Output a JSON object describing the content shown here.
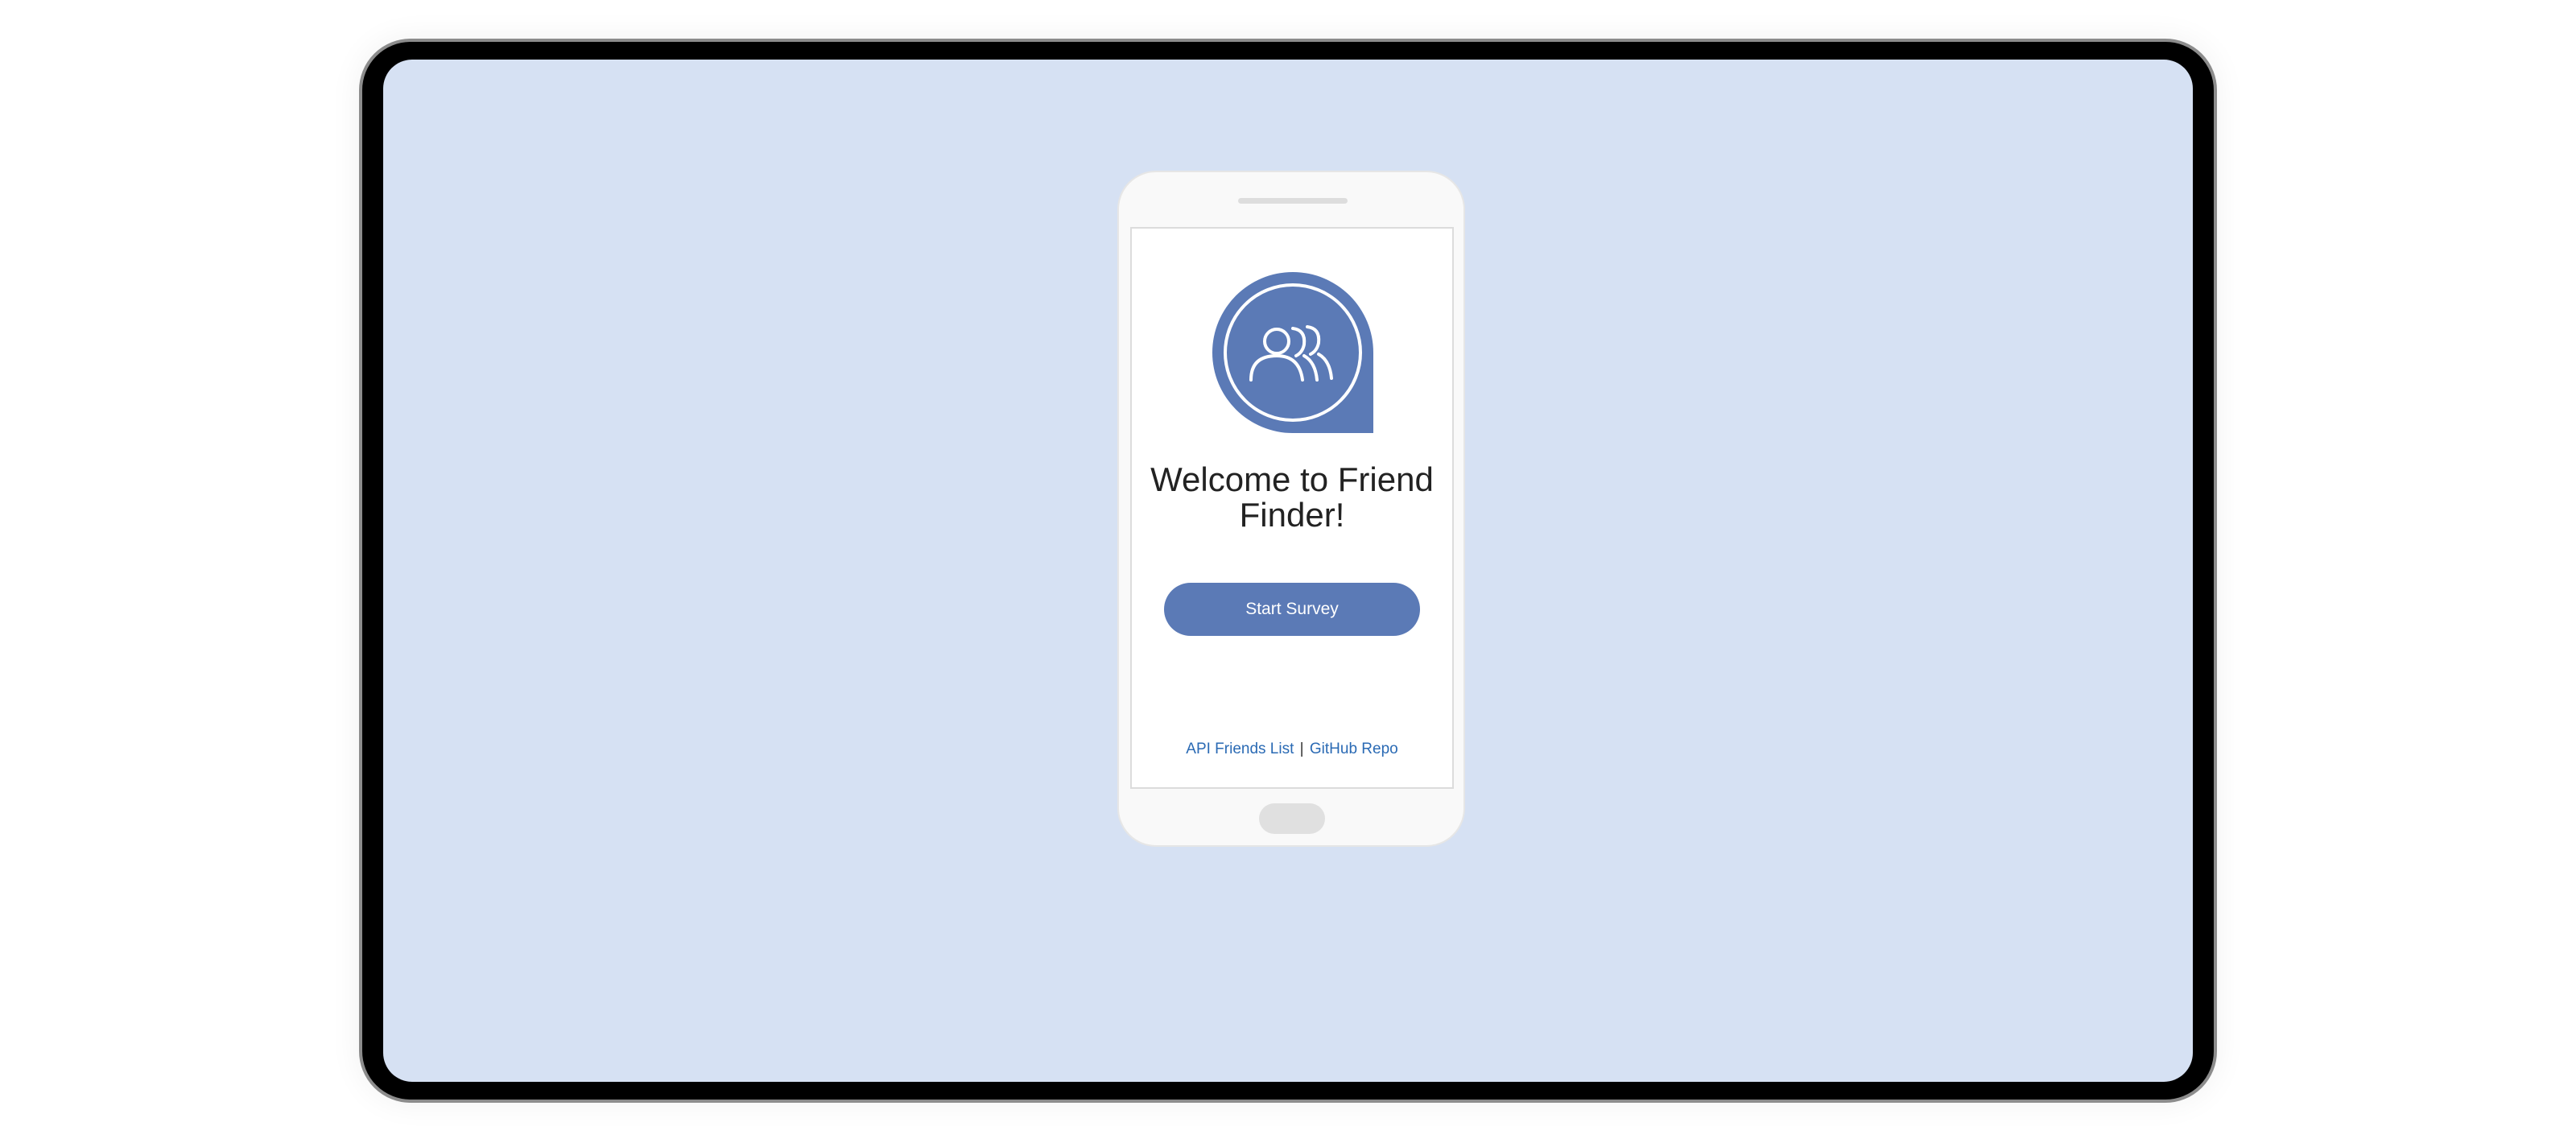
{
  "app": {
    "title": "Welcome to Friend Finder!",
    "start_button_label": "Start Survey",
    "logo_icon": "people-group-icon"
  },
  "footer": {
    "api_link_label": "API Friends List",
    "separator": "|",
    "repo_link_label": "GitHub Repo"
  },
  "colors": {
    "background": "#d6e1f3",
    "accent": "#5b7ab6",
    "link": "#2a6ab4"
  }
}
